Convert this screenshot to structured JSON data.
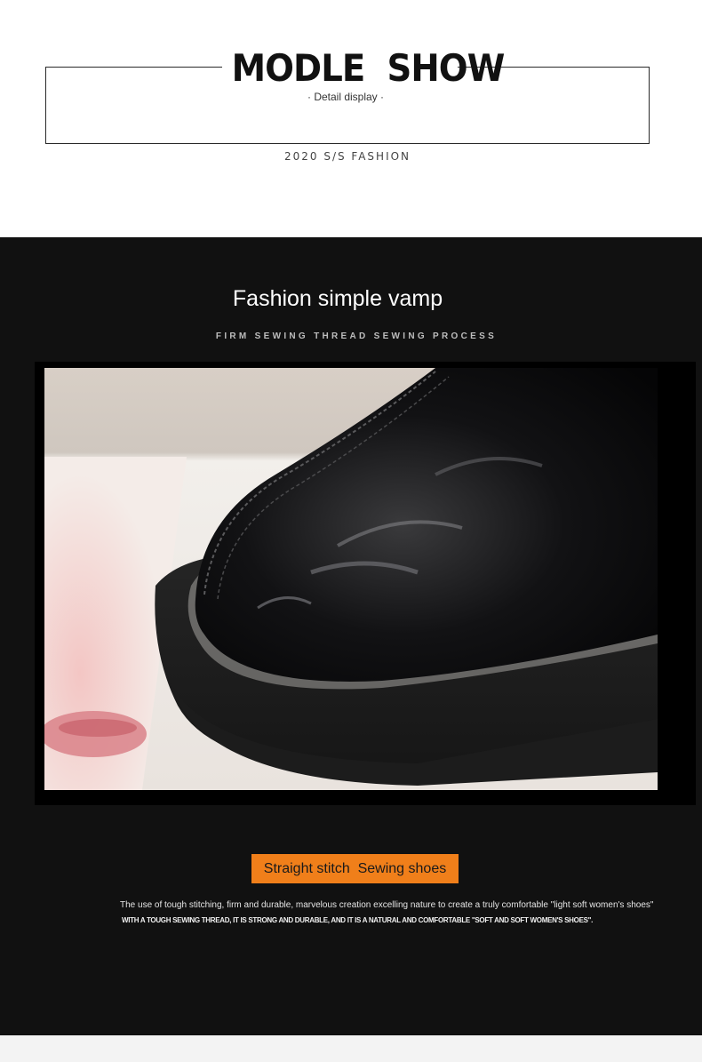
{
  "header": {
    "title": "MODLE  SHOW",
    "subtitle": "· Detail display ·",
    "season": "2020 S/S FASHION"
  },
  "feature": {
    "heading": "Fashion simple vamp",
    "tagline": "FIRM SEWING THREAD SEWING PROCESS",
    "badge": "Straight stitch  Sewing shoes",
    "description": "The use of tough stitching, firm and durable, marvelous creation excelling nature to create a truly comfortable \"light soft women's shoes\"",
    "description_caps": "WITH A TOUGH SEWING THREAD, IT IS STRONG AND DURABLE, AND IT IS A NATURAL AND COMFORTABLE \"SOFT AND SOFT WOMEN'S SHOES\"."
  },
  "colors": {
    "dark_background": "#111111",
    "accent_badge": "#f07f1a",
    "light_background": "#ffffff"
  }
}
